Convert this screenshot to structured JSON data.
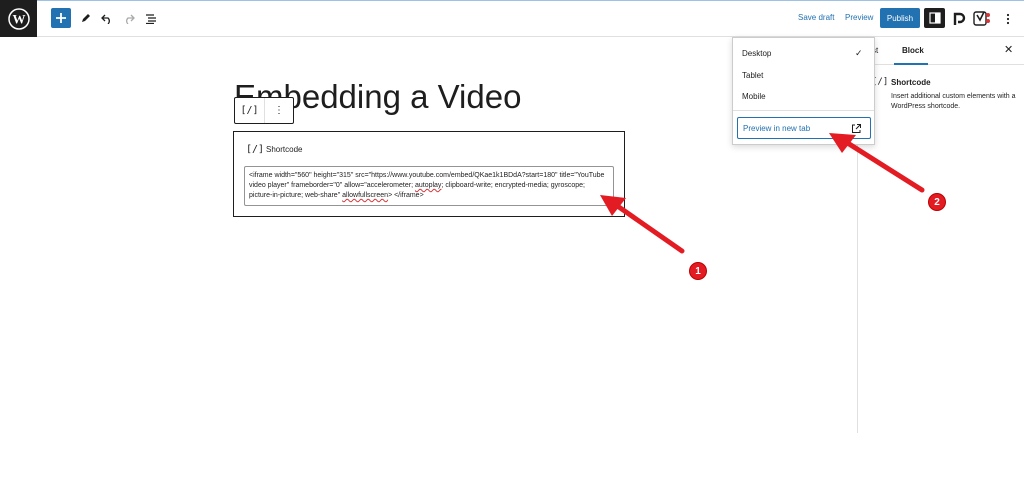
{
  "toolbar": {
    "save_draft": "Save draft",
    "preview": "Preview",
    "publish": "Publish"
  },
  "post": {
    "title": "Embedding a Video"
  },
  "block_toolbar": {
    "type_icon": "[/]",
    "more_icon": "⋮"
  },
  "shortcode_block": {
    "icon": "[/]",
    "label": "Shortcode",
    "content_part1": "<iframe width=\"560\" height=\"315\" src=\"https://www.youtube.com/embed/QKae1k1BDdA?start=180\" title=\"YouTube video player\" frameborder=\"0\" allow=\"accelerometer; ",
    "content_autoplay": "autoplay",
    "content_part2": "; clipboard-write; encrypted-media; gyroscope; picture-in-picture; web-share\" ",
    "content_allowfullscreen": "allowfullscreen",
    "content_part3": "> </iframe>"
  },
  "preview_menu": {
    "items": [
      "Desktop",
      "Tablet",
      "Mobile"
    ],
    "selected": "Desktop",
    "new_tab_label": "Preview in new tab"
  },
  "sidebar": {
    "tab_post": "st",
    "tab_block": "Block",
    "block_icon": "[/]",
    "block_title": "Shortcode",
    "block_description": "Insert additional custom elements with a WordPress shortcode."
  },
  "annotations": {
    "badge_1": "1",
    "badge_2": "2"
  },
  "colors": {
    "accent": "#2271b1",
    "annotation_red": "#e31b23",
    "dark": "#1e1e1e"
  }
}
